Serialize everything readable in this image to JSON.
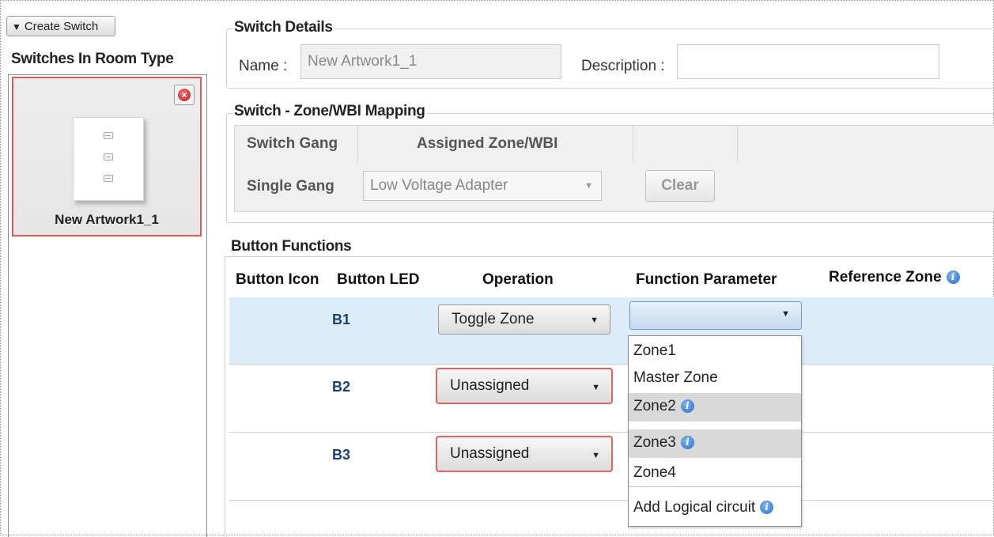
{
  "left": {
    "create_button_label": "Create Switch",
    "section_title": "Switches In Room Type",
    "switch_card_label": "New Artwork1_1"
  },
  "switch_details": {
    "legend": "Switch Details",
    "name_label": "Name :",
    "name_value": "New Artwork1_1",
    "description_label": "Description :",
    "description_value": ""
  },
  "mapping": {
    "legend": "Switch - Zone/WBI Mapping",
    "headers": [
      "Switch Gang",
      "Assigned Zone/WBI"
    ],
    "row_gang": "Single Gang",
    "row_zone": "Low Voltage Adapter",
    "clear_label": "Clear"
  },
  "button_functions": {
    "legend": "Button Functions",
    "headers": {
      "button_icon": "Button Icon",
      "button_led": "Button LED",
      "operation": "Operation",
      "function_parameter": "Function Parameter",
      "reference_zone": "Reference Zone"
    },
    "rows": [
      {
        "button": "B1",
        "operation": "Toggle Zone",
        "parameter": ""
      },
      {
        "button": "B2",
        "operation": "Unassigned"
      },
      {
        "button": "B3",
        "operation": "Unassigned"
      }
    ]
  },
  "dropdown": {
    "items": [
      "Zone1",
      "Master Zone",
      "Zone2",
      "Zone3",
      "Zone4",
      "Add Logical circuit"
    ],
    "highlighted": [
      "Zone2",
      "Zone3"
    ]
  },
  "colors": {
    "selected_row": "#dcedf9",
    "invalid_border": "#e06565",
    "info_blue": "#2a6fc7"
  }
}
